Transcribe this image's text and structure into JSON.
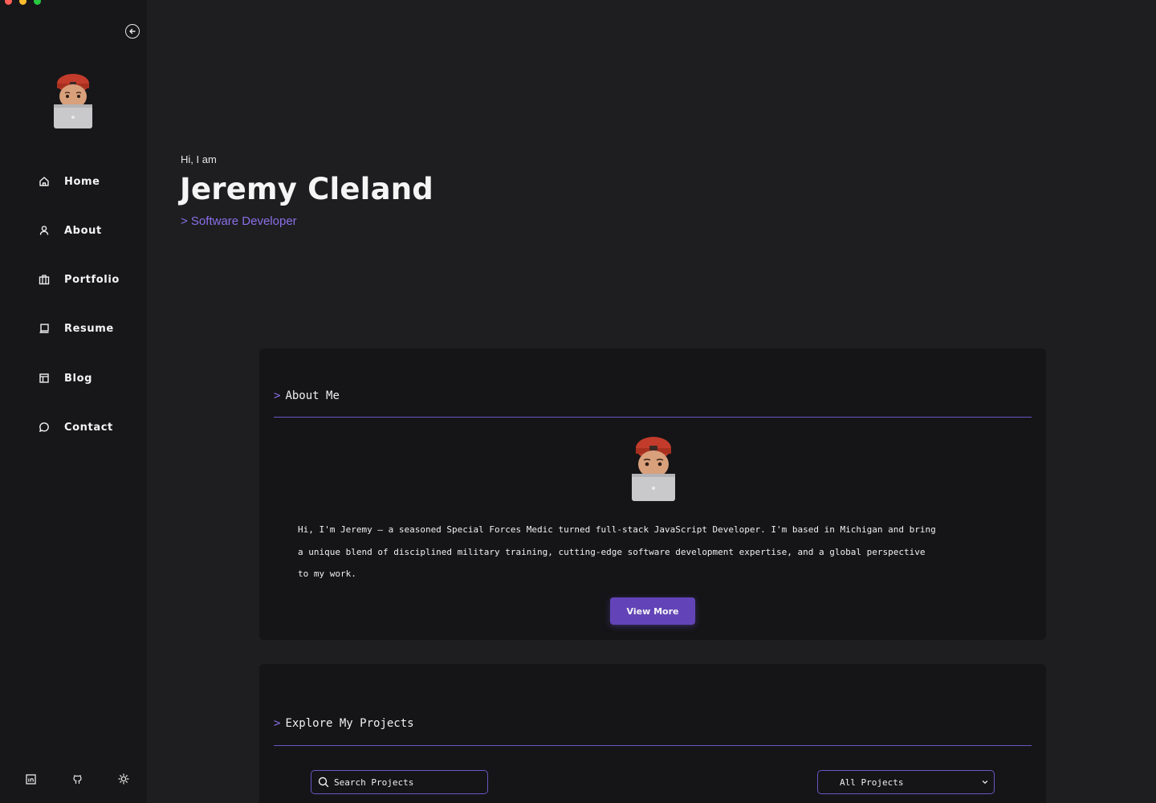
{
  "window": {
    "controls": [
      "close",
      "minimize",
      "zoom"
    ]
  },
  "sidebar": {
    "collapse_icon": "arrow-left-circle-icon",
    "avatar_icon": "memoji-avatar",
    "items": [
      {
        "label": "Home",
        "icon": "home-icon"
      },
      {
        "label": "About",
        "icon": "user-icon"
      },
      {
        "label": "Portfolio",
        "icon": "briefcase-icon"
      },
      {
        "label": "Resume",
        "icon": "laptop-icon"
      },
      {
        "label": "Blog",
        "icon": "layout-icon"
      },
      {
        "label": "Contact",
        "icon": "message-circle-icon"
      }
    ],
    "footer_icons": [
      "linkedin-icon",
      "github-icon",
      "sun-icon"
    ]
  },
  "hero": {
    "greeting": "Hi, I am",
    "name": "Jeremy Cleland",
    "role": "> Software Developer"
  },
  "about": {
    "caret": ">",
    "title": "About Me",
    "text": "Hi, I'm Jeremy — a seasoned Special Forces Medic turned full-stack JavaScript Developer. I'm based in Michigan and bring a unique blend of disciplined military training, cutting-edge software development expertise, and a global perspective to my work.",
    "button": "View More"
  },
  "projects": {
    "caret": ">",
    "title": "Explore My Projects",
    "search_placeholder": "Search Projects",
    "filter_value": "All Projects"
  },
  "colors": {
    "accent": "#6a55c6",
    "accent_text": "#8b6fe8",
    "button": "#6244b8",
    "background": "#1e1e20",
    "sidebar": "#171719",
    "card": "#151517"
  }
}
